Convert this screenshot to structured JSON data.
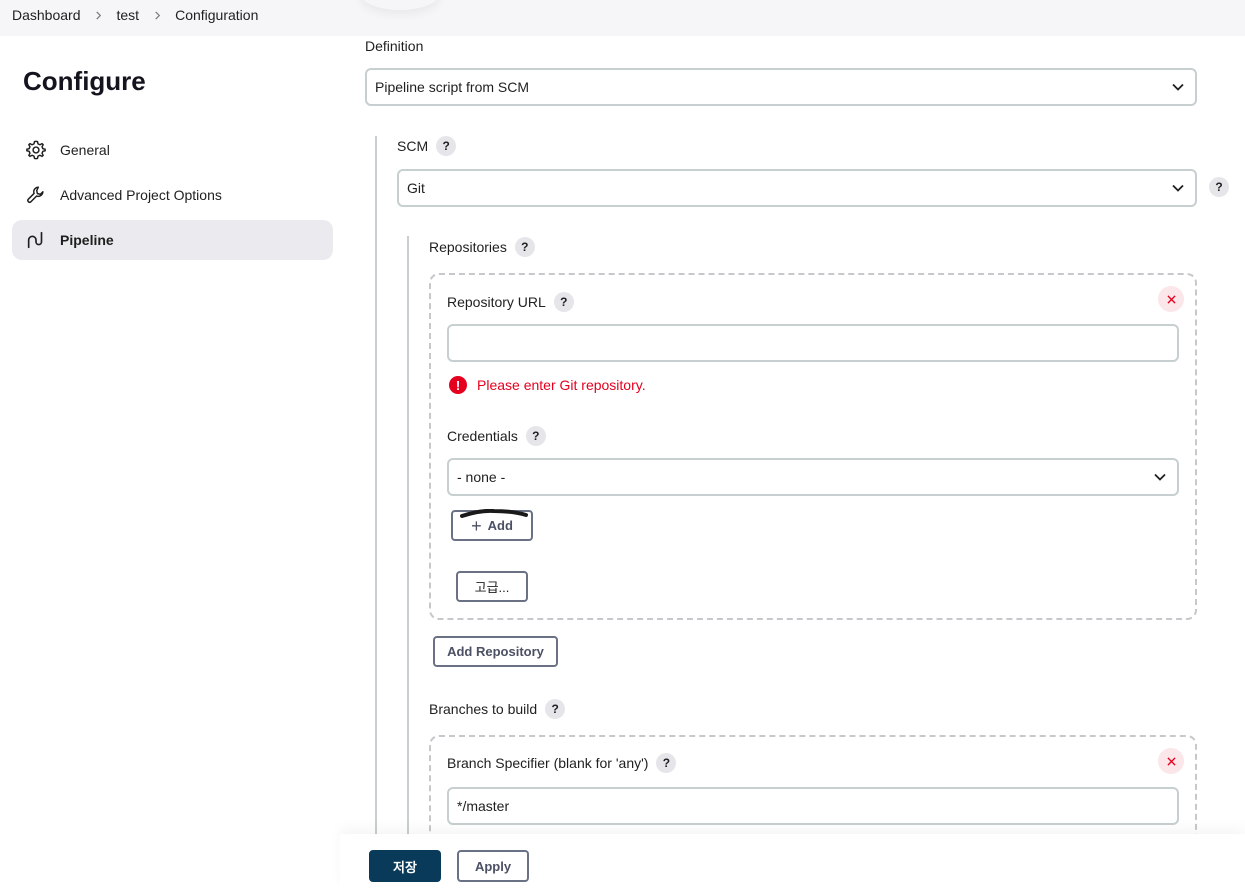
{
  "breadcrumb": {
    "items": [
      "Dashboard",
      "test",
      "Configuration"
    ]
  },
  "sidebar": {
    "title": "Configure",
    "items": [
      {
        "label": "General",
        "icon": "gear-icon"
      },
      {
        "label": "Advanced Project Options",
        "icon": "wrench-icon"
      },
      {
        "label": "Pipeline",
        "icon": "pipeline-icon",
        "active": true
      }
    ]
  },
  "definition": {
    "label": "Definition",
    "value": "Pipeline script from SCM"
  },
  "scm": {
    "label": "SCM",
    "value": "Git",
    "help": "?"
  },
  "repositories": {
    "label": "Repositories",
    "url_label": "Repository URL",
    "url_value": "",
    "error_icon": "!",
    "error": "Please enter Git repository.",
    "credentials_label": "Credentials",
    "credentials_value": "- none -",
    "add_label": "Add",
    "advanced_label": "고급...",
    "add_repository_label": "Add Repository"
  },
  "branches": {
    "label": "Branches to build",
    "spec_label": "Branch Specifier (blank for 'any')",
    "spec_value": "*/master"
  },
  "footer": {
    "save_label": "저장",
    "apply_label": "Apply"
  },
  "colors": {
    "primary": "#093a5a",
    "error": "#e6001f",
    "active_bg": "#ebebef",
    "border": "#c8cfd0"
  }
}
